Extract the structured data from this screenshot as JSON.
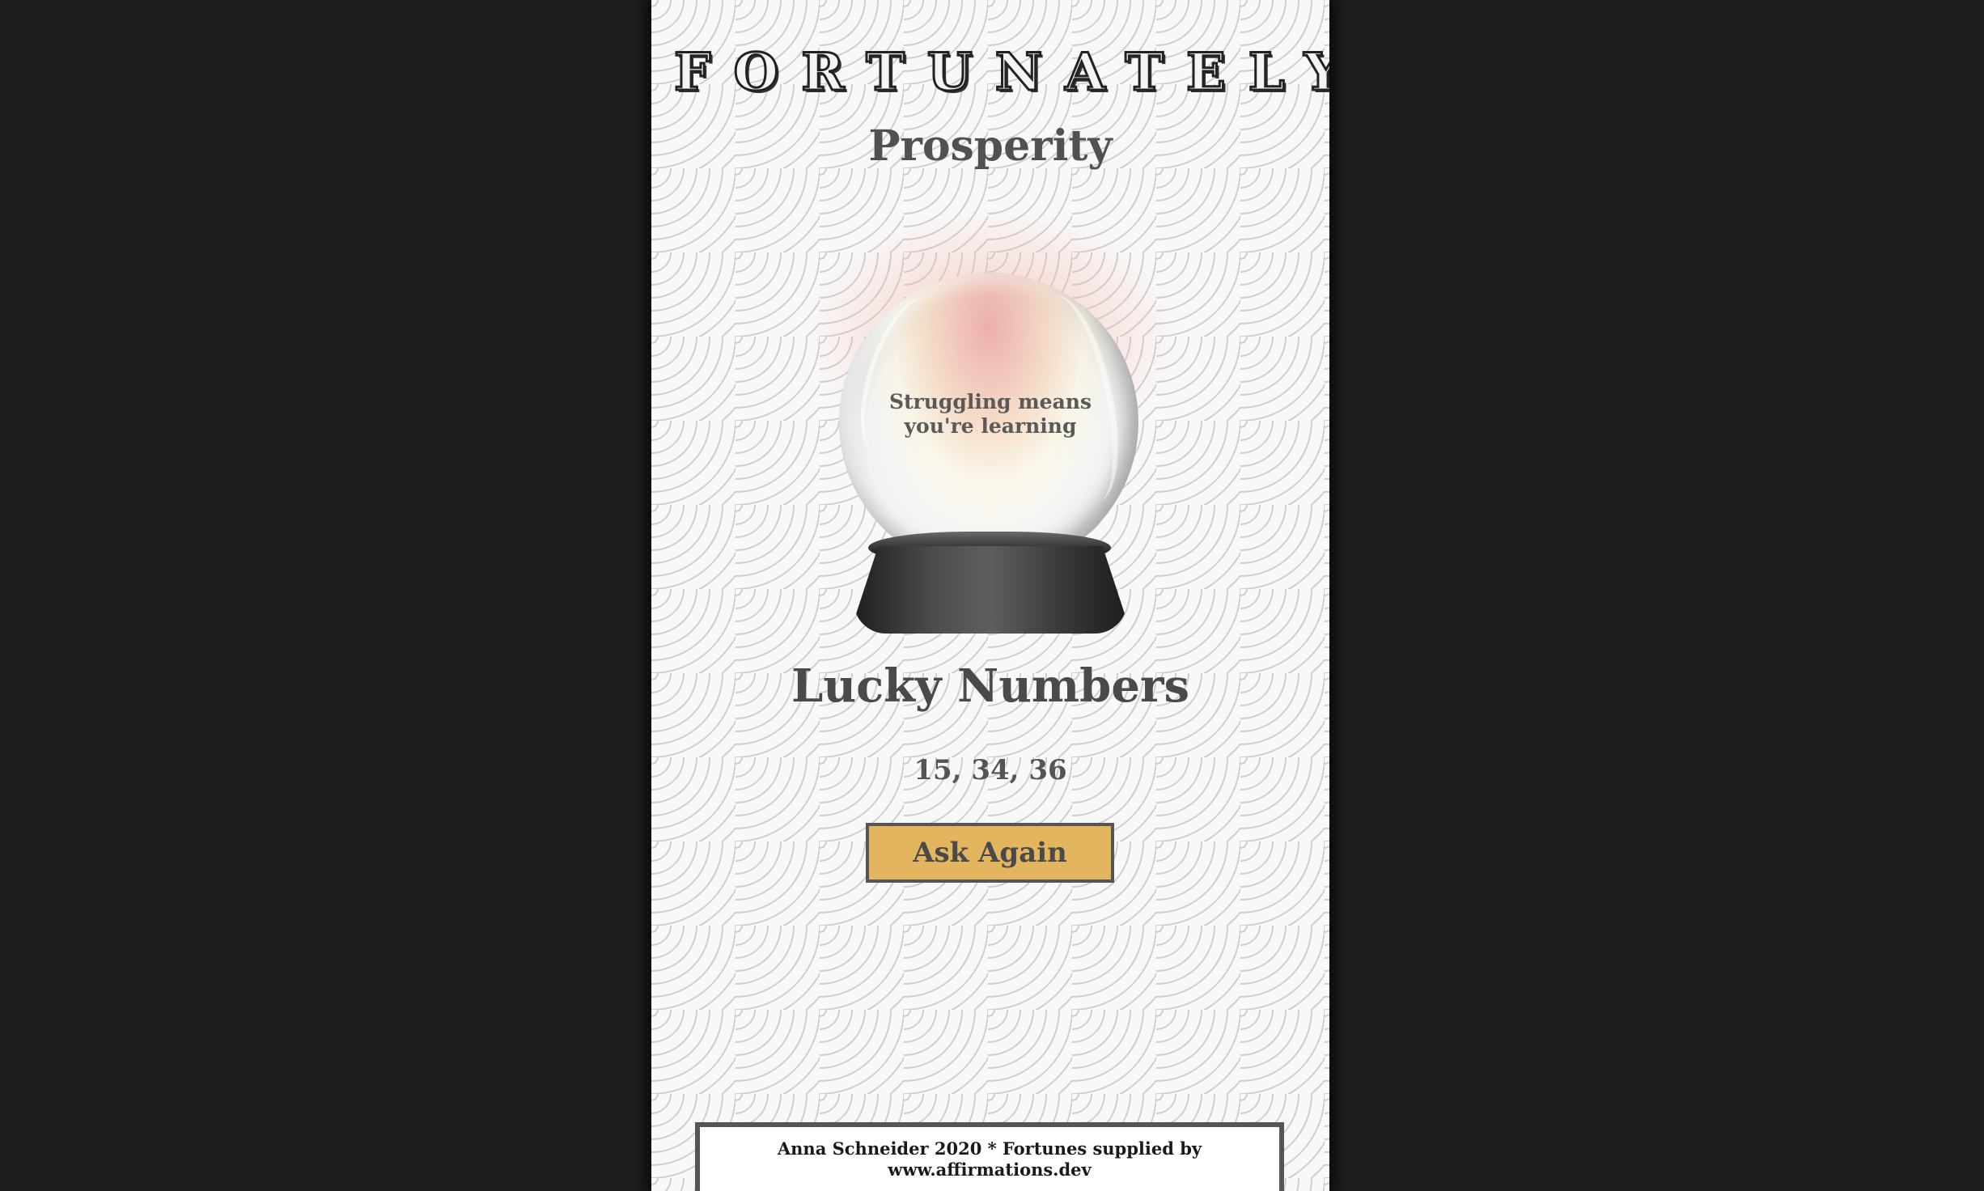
{
  "header": {
    "app_title": "FORTUNATELY",
    "category": "Prosperity"
  },
  "crystal_ball": {
    "fortune_text": "Struggling means you're learning"
  },
  "lucky": {
    "heading": "Lucky Numbers",
    "numbers": "15, 34, 36"
  },
  "actions": {
    "ask_again_label": "Ask Again"
  },
  "footer": {
    "line1": "Anna Schneider 2020 * Fortunes supplied by",
    "line2": "www.affirmations.dev"
  },
  "colors": {
    "page_background": "#1e1e1e",
    "panel_background": "#f4f4f4",
    "button_accent": "#e4b55f",
    "text_dark": "#4a4a4a"
  }
}
